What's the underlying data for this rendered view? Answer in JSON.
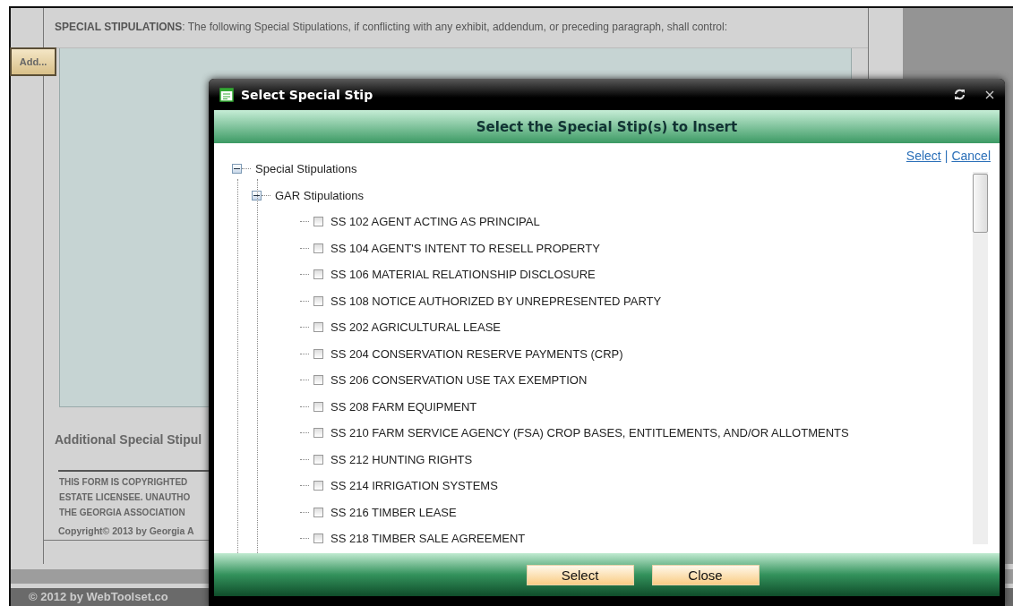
{
  "page": {
    "heading": "**SPECIAL STIPULATIONS**: The following Special Stipulations, if conflicting with any exhibit, addendum, or preceding paragraph, shall control:",
    "add_button": "Add...",
    "additional_label": "Additional Special Stipul",
    "notice_lines": [
      "THIS FORM IS COPYRIGHTED",
      "ESTATE LICENSEE. UNAUTHO",
      "THE GEORGIA ASSOCIATION"
    ],
    "copyright": "Copyright© 2013 by Georgia A",
    "footer": "© 2012 by WebToolset.co"
  },
  "dialog": {
    "title": "Select Special Stip",
    "header": "Select the Special Stip(s) to Insert",
    "links": [
      "Select",
      "Cancel"
    ],
    "link_separator": "|",
    "tree": [
      {
        "label": "Special Stipulations",
        "expanded": true,
        "children": [
          {
            "label": "GAR Stipulations",
            "expanded": true,
            "children": [
              {
                "label": "SS 102 AGENT ACTING AS PRINCIPAL",
                "checked": false
              },
              {
                "label": "SS 104 AGENT'S INTENT TO RESELL PROPERTY",
                "checked": false
              },
              {
                "label": "SS 106 MATERIAL RELATIONSHIP DISCLOSURE",
                "checked": false
              },
              {
                "label": "SS 108 NOTICE AUTHORIZED BY UNREPRESENTED PARTY",
                "checked": false
              },
              {
                "label": "SS 202 AGRICULTURAL LEASE",
                "checked": false
              },
              {
                "label": "SS 204 CONSERVATION RESERVE PAYMENTS (CRP)",
                "checked": false
              },
              {
                "label": "SS 206 CONSERVATION USE TAX EXEMPTION",
                "checked": false
              },
              {
                "label": "SS 208 FARM EQUIPMENT",
                "checked": false
              },
              {
                "label": "SS 210 FARM SERVICE AGENCY (FSA) CROP BASES, ENTITLEMENTS, AND/OR ALLOTMENTS",
                "checked": false
              },
              {
                "label": "SS 212 HUNTING RIGHTS",
                "checked": false
              },
              {
                "label": "SS 214 IRRIGATION SYSTEMS",
                "checked": false
              },
              {
                "label": "SS 216 TIMBER LEASE",
                "checked": false
              },
              {
                "label": "SS 218 TIMBER SALE AGREEMENT",
                "checked": false
              }
            ]
          }
        ]
      }
    ],
    "buttons": [
      "Select",
      "Close"
    ]
  }
}
